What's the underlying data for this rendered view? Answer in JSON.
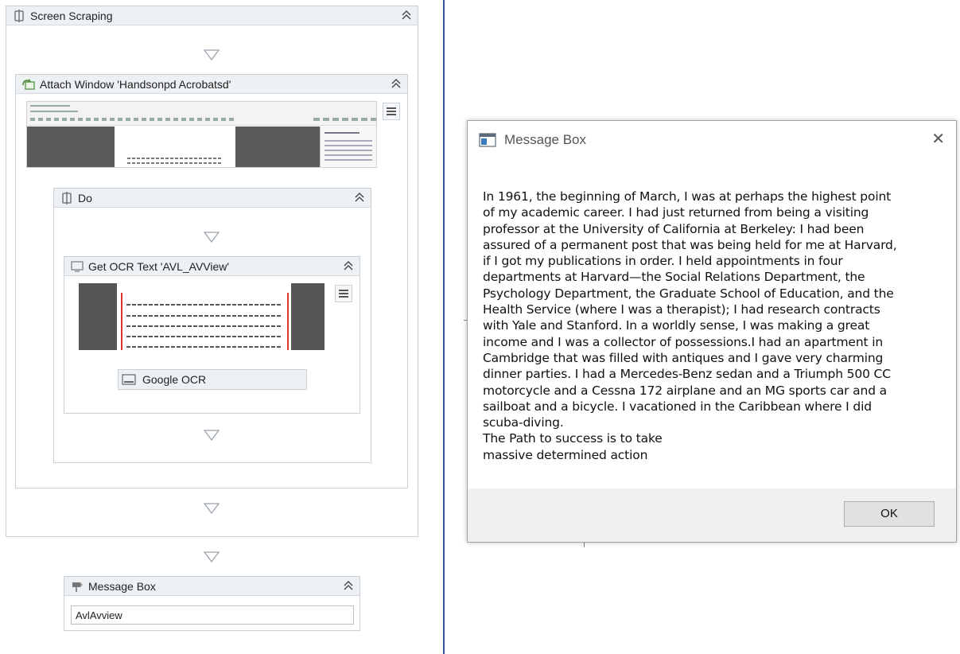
{
  "workflow": {
    "screen_scraping": {
      "title": "Screen Scraping"
    },
    "attach_window": {
      "title": "Attach Window 'Handsonpd Acrobatsd'"
    },
    "do": {
      "title": "Do"
    },
    "get_ocr": {
      "title": "Get OCR Text 'AVL_AVView'",
      "engine_label": "Google OCR"
    },
    "message_box": {
      "title": "Message Box",
      "text_value": "AvlAvview"
    }
  },
  "dialog": {
    "title": "Message Box",
    "body": "In 1961, the beginning of March, I was at perhaps the highest point\nof my academic career. I had just returned from being a visiting\nprofessor at the University of California at Berkeley: I had been\nassured of a permanent post that was being held for me at Harvard,\nif I got my publications in order. I held appointments in four\ndepartments at Harvard—the Social Relations Department, the\nPsychology Department, the Graduate School of Education, and the\nHealth Service (where I was a therapist); I had research contracts\nwith Yale and Stanford. In a worldly sense, I was making a great\nincome and I was a collector of possessions.I had an apartment in\nCambridge that was filled with antiques and I gave very charming\ndinner parties. I had a Mercedes-Benz sedan and a Triumph 500 CC\nmotorcycle and a Cessna 172 airplane and an MG sports car and a\nsailboat and a bicycle. I vacationed in the Caribbean where I did\nscuba-diving.\nThe Path to success is to take\nmassive determined action",
    "ok_label": "OK",
    "close_glyph": "✕"
  }
}
